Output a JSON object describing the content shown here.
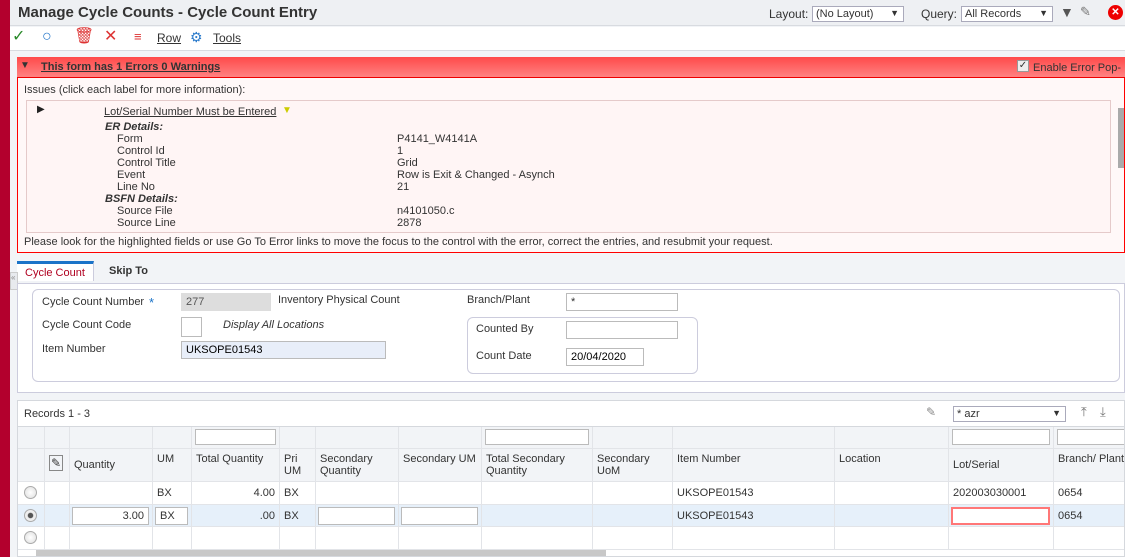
{
  "title": "Manage Cycle Counts - Cycle Count Entry",
  "header": {
    "layout_label": "Layout:",
    "layout_value": "(No Layout)",
    "query_label": "Query:",
    "query_value": "All Records"
  },
  "toolbar": {
    "row_label": "Row",
    "tools_label": "Tools"
  },
  "errors": {
    "summary": "This form has 1 Errors 0 Warnings",
    "enable_popup": "Enable Error Pop-",
    "issues_label": "Issues (click each label for more information):",
    "issue_title": "Lot/Serial Number Must be Entered",
    "er_details": "ER Details:",
    "er": [
      [
        "Form",
        "P4141_W4141A"
      ],
      [
        "Control Id",
        "1"
      ],
      [
        "Control Title",
        "Grid"
      ],
      [
        "Event",
        "Row is Exit & Changed - Asynch"
      ],
      [
        "Line No",
        "21"
      ]
    ],
    "bsfn_details": "BSFN Details:",
    "bsfn": [
      [
        "Source File",
        "n4101050.c"
      ],
      [
        "Source Line",
        "2878"
      ]
    ],
    "footer": "Please look for the highlighted fields or use Go To Error links to move the focus to the control with the error, correct the entries, and resubmit your request."
  },
  "tabs": [
    "Cycle Count",
    "Skip To"
  ],
  "form": {
    "cycle_count_number_label": "Cycle Count Number",
    "cycle_count_number": "277",
    "cycle_count_desc": "Inventory Physical Count",
    "cycle_count_code_label": "Cycle Count Code",
    "display_all": "Display All Locations",
    "item_number_label": "Item Number",
    "item_number": "UKSOPE01543",
    "branch_label": "Branch/Plant",
    "branch": "*",
    "counted_by_label": "Counted By",
    "counted_by": "",
    "count_date_label": "Count Date",
    "count_date": "20/04/2020"
  },
  "grid": {
    "records": "Records 1 - 3",
    "view": "* azr",
    "columns": [
      "Quantity",
      "UM",
      "Total Quantity",
      "Pri UM",
      "Secondary Quantity",
      "Secondary UM",
      "Total Secondary Quantity",
      "Secondary UoM",
      "Item Number",
      "Location",
      "Lot/Serial",
      "Branch/ Plant"
    ],
    "rows": [
      [
        "",
        "BX",
        "4.00",
        "BX",
        "",
        "",
        "",
        "",
        "UKSOPE01543",
        "",
        "202003030001",
        "0654"
      ],
      [
        "3.00",
        "BX",
        ".00",
        "BX",
        "",
        "",
        "",
        "",
        "UKSOPE01543",
        "",
        "",
        "0654"
      ],
      [
        "",
        "",
        "",
        "",
        "",
        "",
        "",
        "",
        "",
        "",
        "",
        ""
      ]
    ]
  }
}
